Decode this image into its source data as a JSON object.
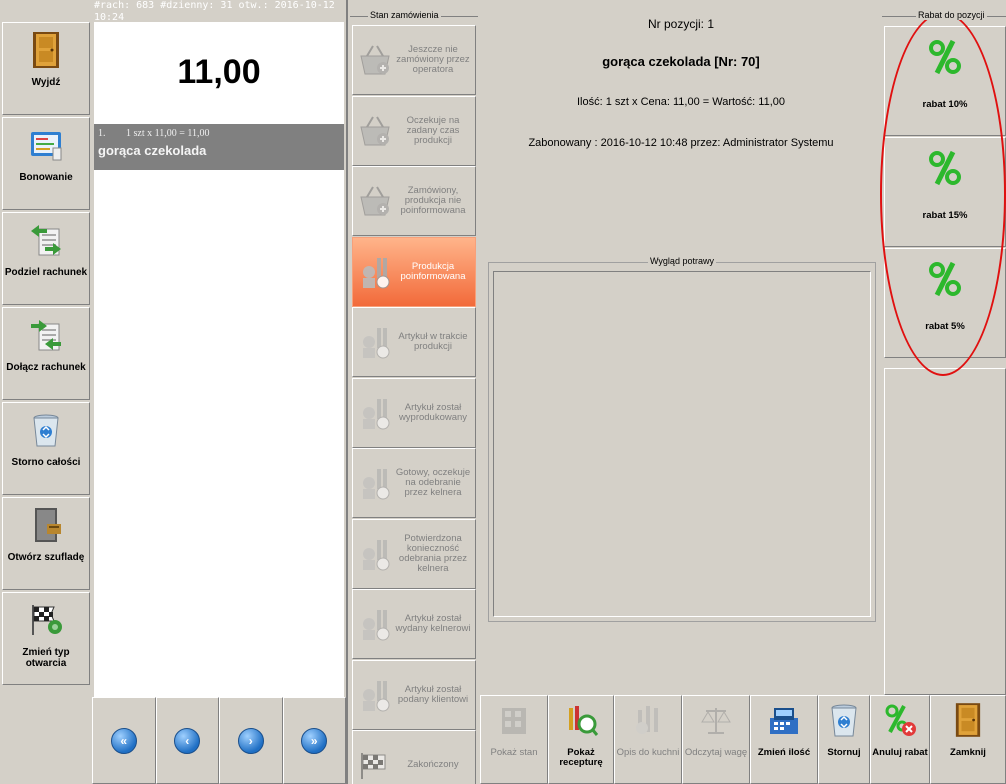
{
  "receipt": {
    "header": "#rach: 683 #dzienny: 31 otw.: 2016-10-12 10:24",
    "total": "11,00",
    "items": [
      {
        "pos": "1.",
        "calc": "1 szt x 11,00 = 11,00",
        "name": "gorąca czekolada"
      }
    ]
  },
  "sidebar": {
    "items": [
      {
        "label": "Wyjdź",
        "icon": "door-icon"
      },
      {
        "label": "Bonowanie",
        "icon": "receipt-print-icon"
      },
      {
        "label": "Podziel rachunek",
        "icon": "split-bill-icon"
      },
      {
        "label": "Dołącz rachunek",
        "icon": "merge-bill-icon"
      },
      {
        "label": "Storno całości",
        "icon": "recycle-bin-icon"
      },
      {
        "label": "Otwórz szufladę",
        "icon": "cash-drawer-icon"
      },
      {
        "label": "Zmień typ otwarcia",
        "icon": "checkered-flag-icon"
      }
    ]
  },
  "nav": {
    "first": "first-page-icon",
    "prev": "prev-page-icon",
    "next": "next-page-icon",
    "last": "last-page-icon"
  },
  "status": {
    "group_title": "Stan zamówienia",
    "items": [
      {
        "label": "Jeszcze nie zamówiony przez operatora",
        "active": false
      },
      {
        "label": "Oczekuje na zadany czas produkcji",
        "active": false
      },
      {
        "label": "Zamówiony, produkcja nie poinformowana",
        "active": false
      },
      {
        "label": "Produkcja poinformowana",
        "active": true
      },
      {
        "label": "Artykuł w trakcie produkcji",
        "active": false
      },
      {
        "label": "Artykuł został wyprodukowany",
        "active": false
      },
      {
        "label": "Gotowy, oczekuje na odebranie przez kelnera",
        "active": false
      },
      {
        "label": "Potwierdzona konieczność odebrania przez kelnera",
        "active": false
      },
      {
        "label": "Artykuł został wydany kelnerowi",
        "active": false
      },
      {
        "label": "Artykuł został podany klientowi",
        "active": false
      },
      {
        "label": "Zakończony",
        "active": false
      }
    ]
  },
  "detail": {
    "pos_number": "Nr pozycji: 1",
    "item_title": "gorąca czekolada [Nr: 70]",
    "calc": "Ilość: 1 szt x Cena: 11,00 = Wartość: 11,00",
    "booked": "Zabonowany : 2016-10-12 10:48 przez: Administrator Systemu",
    "dish_box_title": "Wygląd potrawy"
  },
  "toolbar": {
    "items": [
      {
        "label": "Pokaż stan",
        "icon": "storage-icon",
        "disabled": true,
        "bold": false
      },
      {
        "label": "Pokaż recepturę",
        "icon": "recipe-icon",
        "disabled": false,
        "bold": true
      },
      {
        "label": "Opis do kuchni",
        "icon": "kitchen-note-icon",
        "disabled": true,
        "bold": false
      },
      {
        "label": "Odczytaj wagę",
        "icon": "scale-icon",
        "disabled": true,
        "bold": false
      },
      {
        "label": "Zmień ilość",
        "icon": "cash-register-icon",
        "disabled": false,
        "bold": true
      },
      {
        "label": "Stornuj",
        "icon": "recycle-bin-icon",
        "disabled": false,
        "bold": true
      },
      {
        "label": "Anuluj rabat",
        "icon": "cancel-discount-icon",
        "disabled": false,
        "bold": true
      },
      {
        "label": "Zamknij",
        "icon": "door-icon",
        "disabled": false,
        "bold": true
      }
    ]
  },
  "discount": {
    "group_title": "Rabat do pozycji",
    "items": [
      {
        "label": "rabat 10%"
      },
      {
        "label": "rabat 15%"
      },
      {
        "label": "rabat 5%"
      }
    ]
  },
  "colors": {
    "background": "#d4d0c8",
    "active_status": "#f26a3a",
    "receipt_item": "#808080",
    "highlight": "#e01010",
    "percent_icon": "#2db82d"
  }
}
